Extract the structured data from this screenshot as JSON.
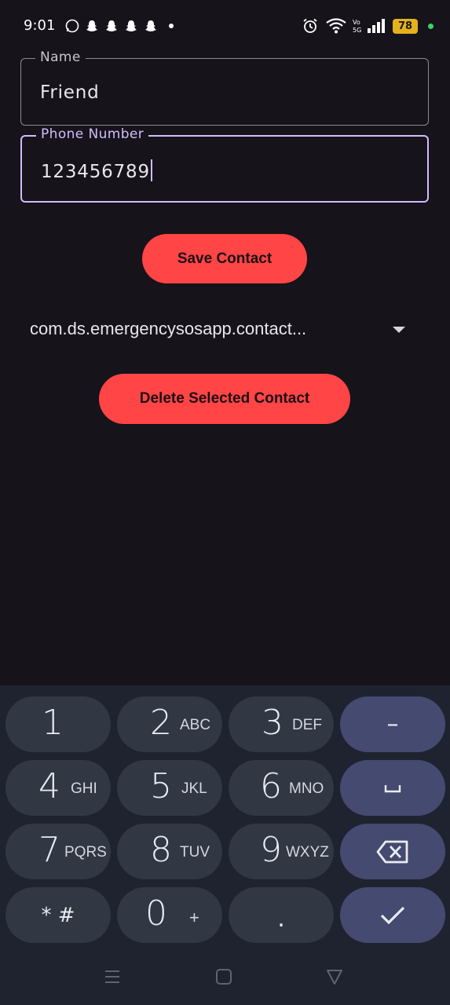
{
  "status_bar": {
    "time": "9:01",
    "battery": "78",
    "notification_icons": [
      "whatsapp-icon",
      "snapchat-icon",
      "snapchat-icon",
      "snapchat-icon",
      "snapchat-icon"
    ],
    "right_icons": [
      "alarm-icon",
      "wifi-icon",
      "volte-5g-icon",
      "signal-icon",
      "battery-icon"
    ]
  },
  "form": {
    "name_label": "Name",
    "name_value": "Friend",
    "phone_label": "Phone Number",
    "phone_value": "123456789"
  },
  "save_button": "Save Contact",
  "dropdown": {
    "selected": "com.ds.emergencysosapp.contact..."
  },
  "delete_button": "Delete Selected Contact",
  "keypad": {
    "keys": [
      {
        "num": "1",
        "letters": ""
      },
      {
        "num": "2",
        "letters": "ABC"
      },
      {
        "num": "3",
        "letters": "DEF"
      },
      {
        "num": "4",
        "letters": "GHI"
      },
      {
        "num": "5",
        "letters": "JKL"
      },
      {
        "num": "6",
        "letters": "MNO"
      },
      {
        "num": "7",
        "letters": "PQRS"
      },
      {
        "num": "8",
        "letters": "TUV"
      },
      {
        "num": "9",
        "letters": "WXYZ"
      },
      {
        "num": "0",
        "letters": "+"
      }
    ],
    "star_hash": "* #",
    "dot": ".",
    "dash": "–",
    "space": "␣",
    "backspace": "⌫",
    "done": "✓"
  },
  "colors": {
    "background": "#16131b",
    "accent": "#ff4545",
    "focus": "#d2bcfd",
    "keypad": "#1f2330"
  }
}
